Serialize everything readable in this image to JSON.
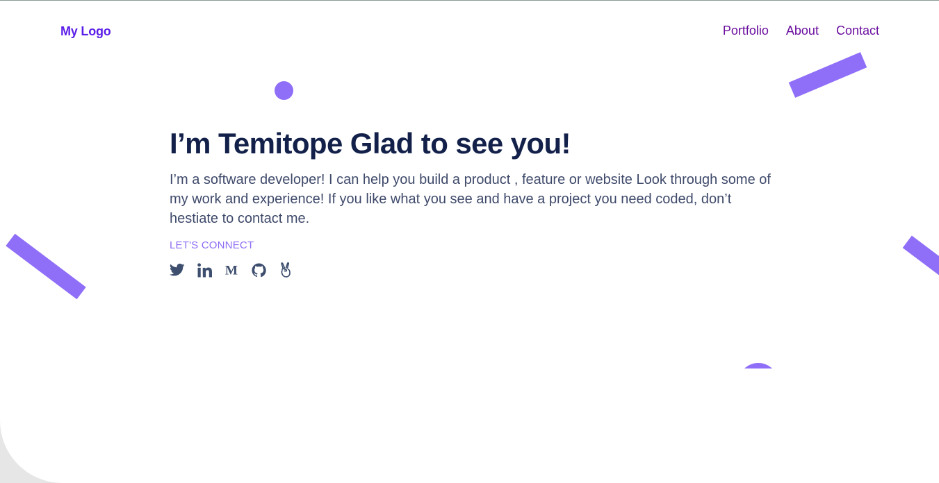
{
  "header": {
    "logo": "My Logo",
    "nav": [
      "Portfolio",
      "About",
      "Contact"
    ]
  },
  "hero": {
    "title": "I’m Temitope Glad to see you!",
    "description": "I’m a software developer! I can help you build a product , feature or website Look through some of my work and experience! If you like what you see and have a project you need coded, don’t hestiate to contact me.",
    "connect_label": "LET'S CONNECT"
  },
  "socials": [
    "twitter-icon",
    "linkedin-icon",
    "medium-icon",
    "github-icon",
    "angellist-icon"
  ],
  "colors": {
    "accent": "#8f6ef8",
    "logo": "#5b1ee8",
    "nav": "#6a0e9e",
    "heading": "#13214a",
    "body": "#3f4a6b",
    "icons": "#3d4e6e"
  }
}
